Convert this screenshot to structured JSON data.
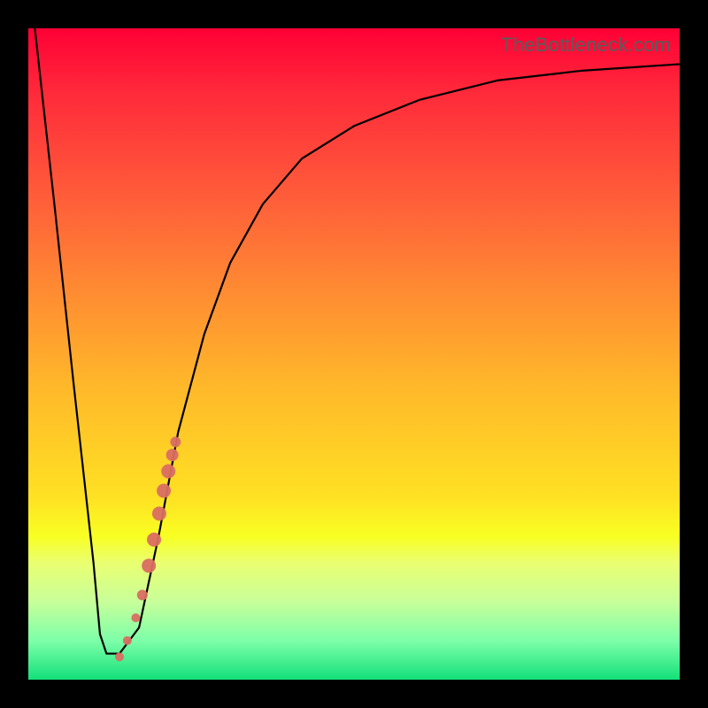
{
  "watermark": "TheBottleneck.com",
  "chart_data": {
    "type": "line",
    "title": "",
    "xlabel": "",
    "ylabel": "",
    "xlim": [
      0,
      100
    ],
    "ylim": [
      0,
      100
    ],
    "grid": false,
    "legend": false,
    "series": [
      {
        "name": "bottleneck-curve",
        "x": [
          1,
          4,
          7,
          10,
          11,
          12,
          14,
          17,
          20,
          23,
          27,
          31,
          36,
          42,
          50,
          60,
          72,
          85,
          100
        ],
        "y": [
          100,
          73,
          45,
          18,
          7,
          4,
          4,
          8,
          22,
          38,
          53,
          64,
          73,
          80,
          85,
          89,
          92,
          93.5,
          94.5
        ]
      }
    ],
    "points": {
      "name": "segment-markers",
      "color": "#d96e62",
      "data": [
        {
          "x": 14.0,
          "y": 3.5,
          "r": 5
        },
        {
          "x": 15.2,
          "y": 6.0,
          "r": 5
        },
        {
          "x": 16.5,
          "y": 9.5,
          "r": 5
        },
        {
          "x": 17.5,
          "y": 13.0,
          "r": 6
        },
        {
          "x": 18.5,
          "y": 17.5,
          "r": 8
        },
        {
          "x": 19.3,
          "y": 21.5,
          "r": 8
        },
        {
          "x": 20.1,
          "y": 25.5,
          "r": 8
        },
        {
          "x": 20.8,
          "y": 29.0,
          "r": 8
        },
        {
          "x": 21.5,
          "y": 32.0,
          "r": 8
        },
        {
          "x": 22.1,
          "y": 34.5,
          "r": 7
        },
        {
          "x": 22.6,
          "y": 36.5,
          "r": 6
        }
      ]
    },
    "gradient_stops": [
      {
        "offset": 0.0,
        "color": "#ff0035"
      },
      {
        "offset": 0.25,
        "color": "#ff5a3a"
      },
      {
        "offset": 0.55,
        "color": "#ffb82a"
      },
      {
        "offset": 0.78,
        "color": "#f8ff22"
      },
      {
        "offset": 1.0,
        "color": "#13e07a"
      }
    ]
  }
}
